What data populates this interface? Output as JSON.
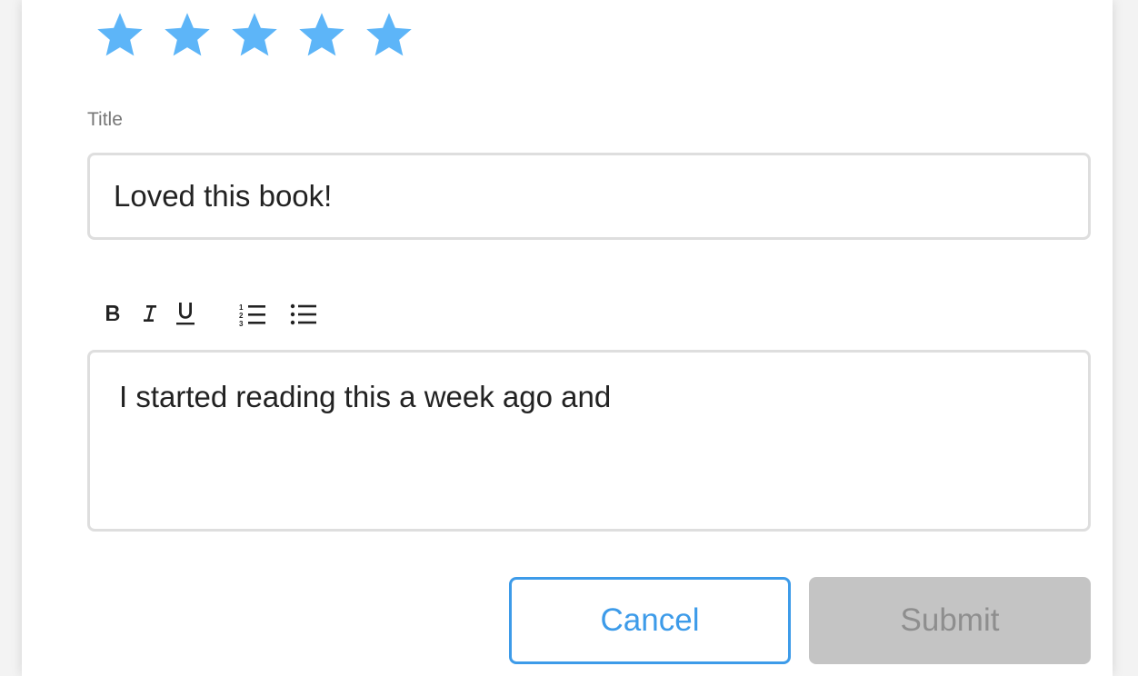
{
  "rating": {
    "value": 5,
    "max": 5,
    "star_color": "#5db5f8",
    "icon": "star-icon"
  },
  "title_field": {
    "label": "Title",
    "value": "Loved this book!"
  },
  "toolbar": {
    "items": [
      {
        "name": "bold",
        "icon": "bold-icon"
      },
      {
        "name": "italic",
        "icon": "italic-icon"
      },
      {
        "name": "underline",
        "icon": "underline-icon"
      },
      {
        "name": "ordered-list",
        "icon": "ordered-list-icon"
      },
      {
        "name": "bullet-list",
        "icon": "bullet-list-icon"
      }
    ]
  },
  "body_field": {
    "value": "I started reading this a week ago and"
  },
  "actions": {
    "cancel_label": "Cancel",
    "submit_label": "Submit",
    "accent_color": "#3d9be9",
    "submit_disabled": true
  }
}
